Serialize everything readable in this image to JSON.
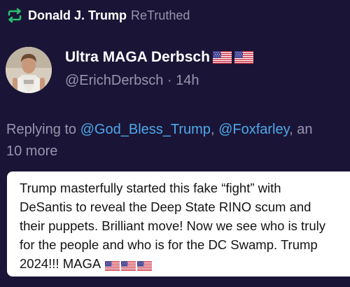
{
  "retruth": {
    "icon": "retruth-icon",
    "name": "Donald J. Trump",
    "label": "ReTruthed",
    "accent": "#2bbf6d"
  },
  "author": {
    "avatar": "avatar",
    "display_name": "Ultra MAGA Derbsch",
    "name_flags": [
      "us-flag-icon",
      "us-flag-icon"
    ],
    "handle": "@ErichDerbsch",
    "separator": "·",
    "time": "14h"
  },
  "reply": {
    "prefix": "Replying to",
    "mentions": [
      "@God_Bless_Trump",
      "@Foxfarley"
    ],
    "comma": ",",
    "suffix": "an",
    "more": "10 more"
  },
  "post": {
    "lines": [
      "Trump masterfully started this fake “fight” with",
      "DeSantis to reveal the Deep State RINO scum and",
      "their puppets. Brilliant move! Now we see who is truly",
      "for the people and who is for the DC Swamp. Trump",
      "2024!!! MAGA"
    ],
    "trailing_flags": [
      "us-flag-icon",
      "us-flag-icon",
      "us-flag-icon"
    ]
  },
  "colors": {
    "background": "#1a1536",
    "muted_text": "#9894ad",
    "mention": "#4fa8ea",
    "card": "#ffffff"
  }
}
